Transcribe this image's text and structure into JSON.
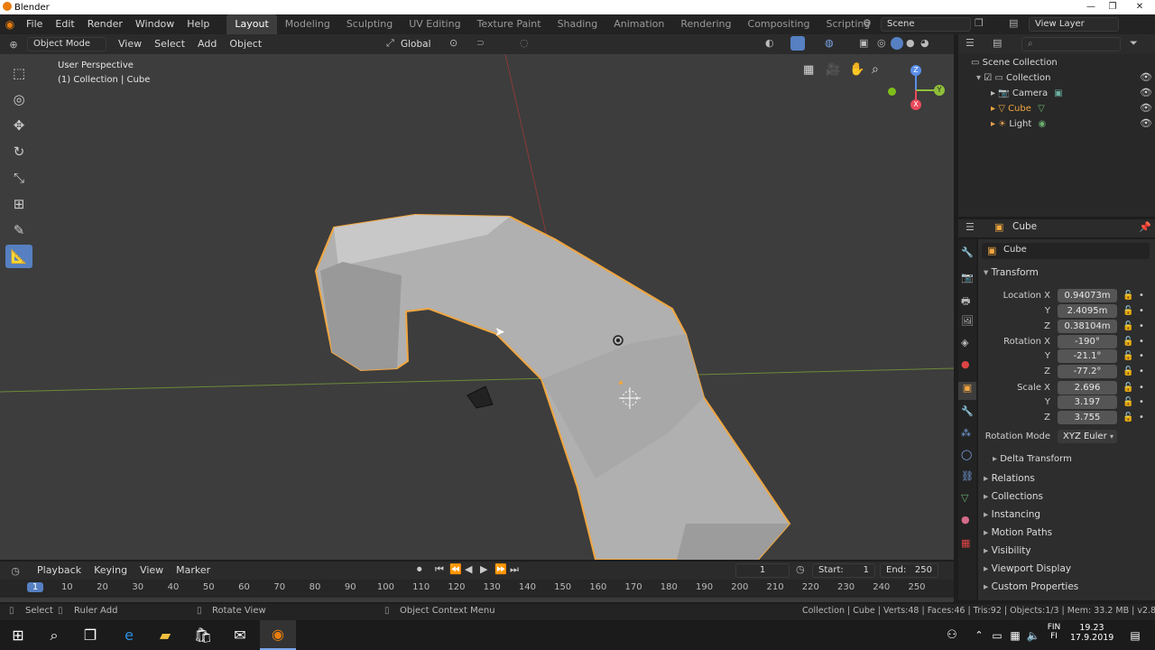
{
  "window": {
    "title": "Blender",
    "controls": [
      "—",
      "❐",
      "✕"
    ]
  },
  "menu": [
    "File",
    "Edit",
    "Render",
    "Window",
    "Help"
  ],
  "workspaces": [
    {
      "label": "Layout",
      "active": true
    },
    {
      "label": "Modeling"
    },
    {
      "label": "Sculpting"
    },
    {
      "label": "UV Editing"
    },
    {
      "label": "Texture Paint"
    },
    {
      "label": "Shading"
    },
    {
      "label": "Animation"
    },
    {
      "label": "Rendering"
    },
    {
      "label": "Compositing"
    },
    {
      "label": "Scripting"
    }
  ],
  "scene": {
    "name": "Scene",
    "view_layer": "View Layer"
  },
  "viewport_header": {
    "mode": "Object Mode",
    "menus": [
      "View",
      "Select",
      "Add",
      "Object"
    ],
    "transform_orientation": "Global"
  },
  "viewport": {
    "perspective": "User Perspective",
    "collection_info": "(1) Collection | Cube",
    "gizmo": {
      "x": "X",
      "y": "Y",
      "z": "Z"
    }
  },
  "outliner": {
    "root": "Scene Collection",
    "collection": "Collection",
    "items": [
      {
        "label": "Camera",
        "color": "#d8d8d8"
      },
      {
        "label": "Cube",
        "color": "#f0a640"
      },
      {
        "label": "Light",
        "color": "#d8d8d8"
      }
    ]
  },
  "properties": {
    "header_object": "Cube",
    "object_name": "Cube",
    "transform_title": "Transform",
    "location": {
      "label": "Location X",
      "x": "0.94073m",
      "y": "2.4095m",
      "z": "0.38104m"
    },
    "rotation": {
      "label": "Rotation X",
      "x": "-190°",
      "y": "-21.1°",
      "z": "-77.2°"
    },
    "scale": {
      "label": "Scale X",
      "x": "2.696",
      "y": "3.197",
      "z": "3.755"
    },
    "axis_y": "Y",
    "axis_z": "Z",
    "rotation_mode_label": "Rotation Mode",
    "rotation_mode": "XYZ Euler",
    "delta_transform": "Delta Transform",
    "panels": [
      "Relations",
      "Collections",
      "Instancing",
      "Motion Paths",
      "Visibility",
      "Viewport Display",
      "Custom Properties"
    ]
  },
  "timeline": {
    "menus": [
      "Playback",
      "Keying",
      "View",
      "Marker"
    ],
    "current_frame": "1",
    "start_label": "Start:",
    "start": "1",
    "end_label": "End:",
    "end": "250",
    "ticks": [
      "1",
      "10",
      "20",
      "30",
      "40",
      "50",
      "60",
      "70",
      "80",
      "90",
      "100",
      "110",
      "120",
      "130",
      "140",
      "150",
      "160",
      "170",
      "180",
      "190",
      "200",
      "210",
      "220",
      "230",
      "240",
      "250"
    ]
  },
  "statusbar": {
    "select": "Select",
    "ruler": "Ruler Add",
    "rotate": "Rotate View",
    "context": "Object Context Menu",
    "stats": "Collection | Cube | Verts:48 | Faces:46 | Tris:92 | Objects:1/3 | Mem: 33.2 MB | v2.80.75"
  },
  "taskbar": {
    "lang1": "FIN",
    "lang2": "FI",
    "time": "19.23",
    "date": "17.9.2019"
  },
  "colors": {
    "accent": "#5680c2",
    "selection_outline": "#f0a640",
    "mesh": "#b4b4b4"
  }
}
